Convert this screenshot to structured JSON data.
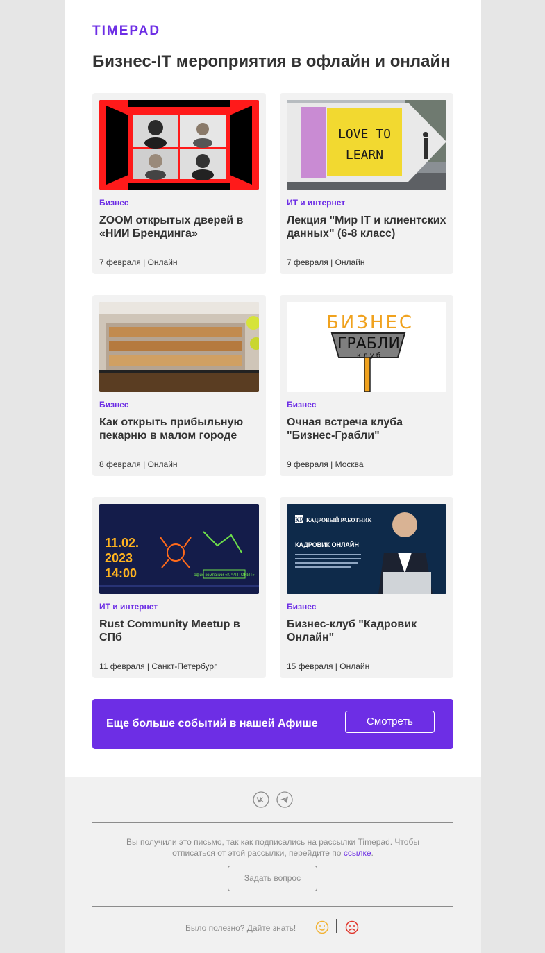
{
  "brand": {
    "logo_text": "TIMEPAD"
  },
  "headline": "Бизнес-IT мероприятия в офлайн и онлайн",
  "events": [
    {
      "category": "Бизнес",
      "title": "ZOOM открытых дверей в «НИИ Брендинга»",
      "meta": "7 февраля | Онлайн"
    },
    {
      "category": "ИТ и интернет",
      "title": "Лекция \"Мир IT и клиентских данных\" (6-8 класс)",
      "meta": "7 февраля | Онлайн"
    },
    {
      "category": "Бизнес",
      "title": "Как открыть прибыльную пекарню в малом городе",
      "meta": "8 февраля  | Онлайн"
    },
    {
      "category": "Бизнес",
      "title": "Очная встреча клуба \"Бизнес-Грабли\"",
      "meta": "9 февраля | Москва"
    },
    {
      "category": "ИТ и интернет",
      "title": "Rust Community Meetup в СПб",
      "meta": "11 февраля | Санкт-Петербург"
    },
    {
      "category": "Бизнес",
      "title": "Бизнес-клуб \"Кадровик Онлайн\"",
      "meta": "15 февраля | Онлайн"
    }
  ],
  "images": {
    "love": {
      "line1": "LOVE TO",
      "line2": "LEARN"
    },
    "grabli": {
      "line1": "БИЗНЕС",
      "line2": "ГРАБЛИ",
      "line3": "к л у б"
    },
    "rust": {
      "date": "11.02.",
      "year": "2023",
      "time": "14:00",
      "sign": "офис компании «КРИПТОНИТ»"
    },
    "kadr": {
      "brand": "КАДРОВЫЙ РАБОТНИК",
      "title": "КАДРОВИК ОНЛАЙН",
      "logo": "КР"
    }
  },
  "banner": {
    "text": "Еще больше событий в нашей Афише",
    "button": "Смотреть"
  },
  "footer": {
    "notice_text": "Вы получили это письмо, так как подписались на рассылки Timepad. Чтобы отписаться от этой рассылки, перейдите по ",
    "notice_link": "ссылке",
    "notice_end": ".",
    "ask_button": "Задать вопрос",
    "feedback": "Было полезно? Дайте знать!"
  },
  "colors": {
    "accent": "#6d2ee5",
    "card_bg": "#f2f2f2",
    "footer_bg": "#f1f1f1",
    "page_bg": "#e6e6e6",
    "muted_text": "#8c8c8c"
  }
}
